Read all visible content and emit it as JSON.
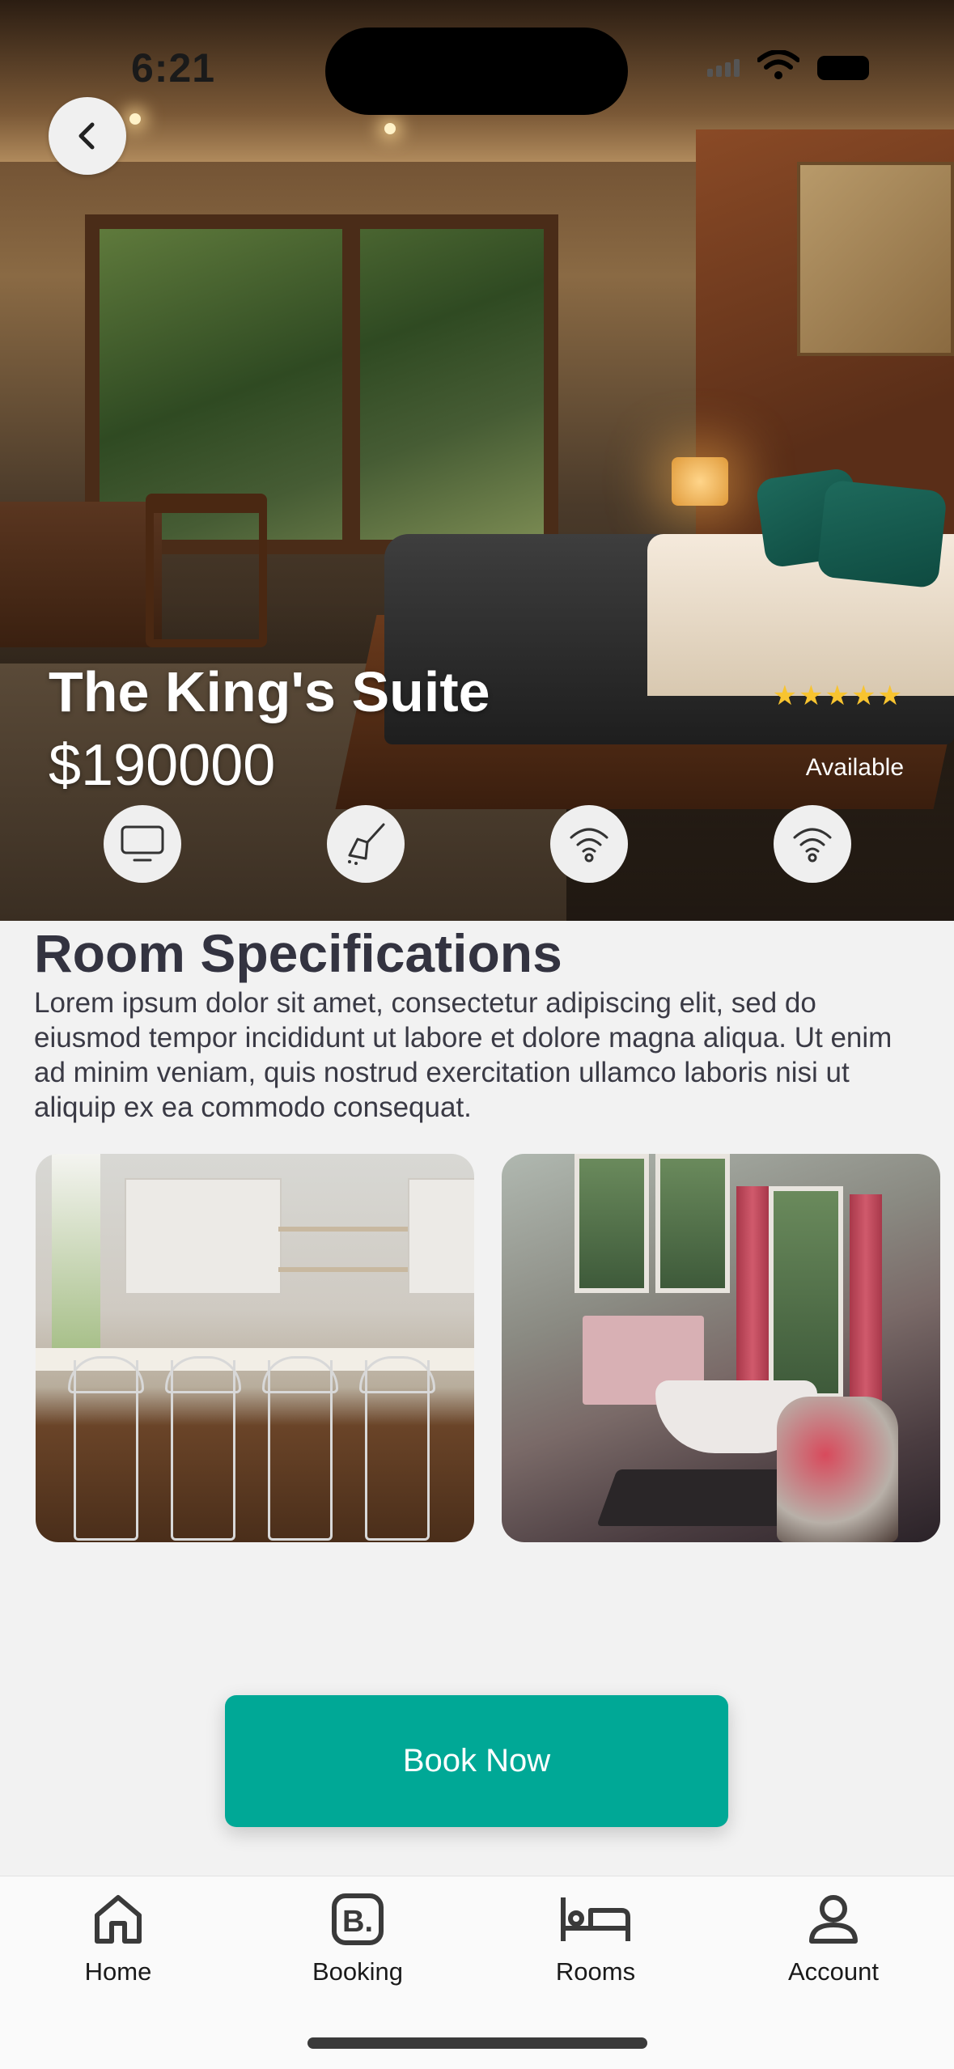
{
  "status_bar": {
    "time": "6:21"
  },
  "room": {
    "name": "The King's Suite",
    "price": "$190000",
    "rating_stars": "★★★★★",
    "availability": "Available",
    "amenities": [
      "tv-icon",
      "broom-icon",
      "wifi-icon",
      "wifi-icon"
    ]
  },
  "specs": {
    "title": "Room Specifications",
    "description": "Lorem ipsum dolor sit amet, consectetur adipiscing elit, sed do eiusmod tempor incididunt ut labore et dolore magna aliqua. Ut enim ad minim veniam, quis nostrud exercitation ullamco laboris nisi ut aliquip ex ea commodo consequat.",
    "photos": [
      "kitchen",
      "bathroom"
    ]
  },
  "cta": {
    "book_label": "Book Now"
  },
  "tabbar": {
    "items": [
      {
        "label": "Home",
        "icon": "home-icon"
      },
      {
        "label": "Booking",
        "icon": "booking-icon"
      },
      {
        "label": "Rooms",
        "icon": "bed-icon"
      },
      {
        "label": "Account",
        "icon": "account-icon"
      }
    ]
  },
  "colors": {
    "accent": "#00a896",
    "star": "#f8c430",
    "background": "#f2f2f2"
  }
}
